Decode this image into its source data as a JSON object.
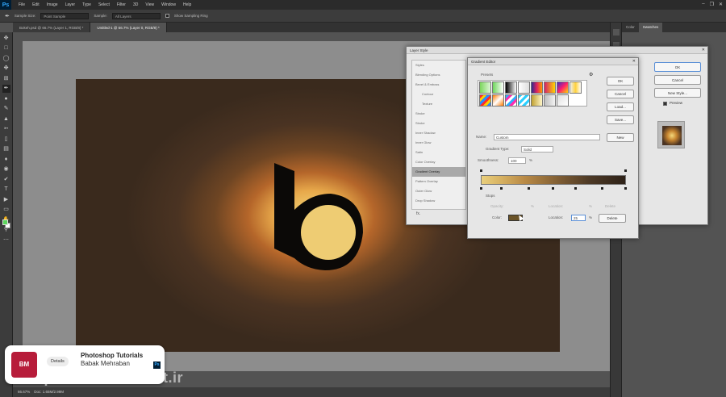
{
  "app": {
    "logo": "Ps"
  },
  "menu": [
    "File",
    "Edit",
    "Image",
    "Layer",
    "Type",
    "Select",
    "Filter",
    "3D",
    "View",
    "Window",
    "Help"
  ],
  "options": {
    "sample_size_label": "Sample Size:",
    "sample_size_value": "Point Sample",
    "sample_label": "Sample:",
    "sample_value": "All Layers",
    "show_ring_label": "Show Sampling Ring"
  },
  "tabs": [
    "Bokeh.psd @ 66.7% (Layer 1, RGB/8) *",
    "Untitled-1 @ 66.7% (Layer 0, RGB/8) *"
  ],
  "right_panel": {
    "tabs": [
      "Color",
      "Swatches"
    ]
  },
  "status": {
    "zoom": "66.67%",
    "doc": "Doc: 1.65M/2.99M"
  },
  "layer_style": {
    "title": "Layer Style",
    "items": [
      "Styles",
      "Blending Options",
      "Bevel & Emboss",
      "Contour",
      "Texture",
      "Stroke",
      "Stroke",
      "Inner Shadow",
      "Inner Glow",
      "Satin",
      "Color Overlay",
      "Gradient Overlay",
      "Pattern Overlay",
      "Outer Glow",
      "Drop Shadow"
    ],
    "fx_label": "fx.",
    "buttons": {
      "ok": "OK",
      "cancel": "Cancel",
      "new_style": "New Style...",
      "preview": "Preview"
    }
  },
  "gradient_editor": {
    "title": "Gradient Editor",
    "presets_label": "Presets",
    "buttons": {
      "ok": "OK",
      "cancel": "Cancel",
      "load": "Load...",
      "save": "Save...",
      "new": "New"
    },
    "name_label": "Name:",
    "name_value": "Custom",
    "type_label": "Gradient Type:",
    "type_value": "Solid",
    "smoothness_label": "Smoothness:",
    "smoothness_value": "100",
    "smoothness_unit": "%",
    "stops_label": "Stops",
    "opacity_label": "Opacity:",
    "opacity_unit": "%",
    "location_label": "Location:",
    "location_unit": "%",
    "delete_label": "Delete",
    "color_label": "Color:",
    "color_location_value": "25",
    "color_location_unit": "%",
    "color_delete_label": "Delete"
  },
  "watermark": {
    "logo_text": "BM",
    "details": "Details",
    "title": "Photoshop Tutorials",
    "author": "Babak Mehraban",
    "ps_badge": "Ps",
    "site": "aparat.com/babart.ir"
  },
  "colors": {
    "foreground": "#5cd65c",
    "background": "#ffffff",
    "gradient_stop_color": "#6b5428",
    "accent": "#31a8ff"
  }
}
